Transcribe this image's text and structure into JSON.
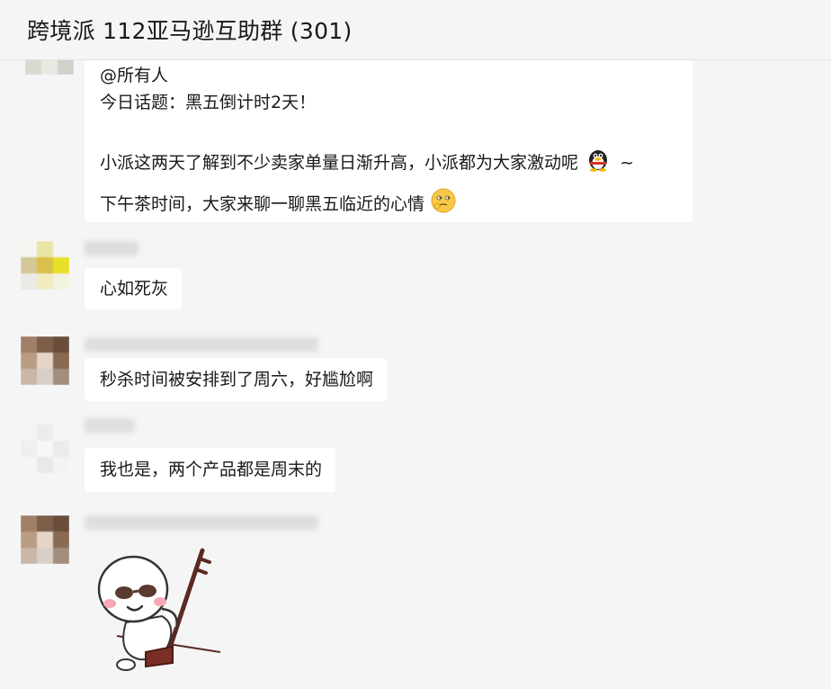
{
  "header": {
    "title": "跨境派 112亚马逊互助群 (301)"
  },
  "messages": [
    {
      "lines": [
        "@所有人",
        "今日话题：黑五倒计时2天！",
        "",
        "小派这两天了解到不少卖家单量日渐升高，小派都为大家激动呢",
        "下午茶时间，大家来聊一聊黑五临近的心情"
      ],
      "line4_suffix": "~",
      "emoji_after_line4": "qq-penguin-icon",
      "emoji_after_line5": "thinking-face-icon"
    },
    {
      "text": "心如死灰"
    },
    {
      "text": "秒杀时间被安排到了周六，好尴尬啊"
    },
    {
      "text": "我也是，两个产品都是周末的"
    },
    {
      "sticker": "erhu-player-sticker"
    }
  ],
  "colors": {
    "background": "#f5f5f5",
    "bubble": "#ffffff",
    "text": "#191919"
  }
}
